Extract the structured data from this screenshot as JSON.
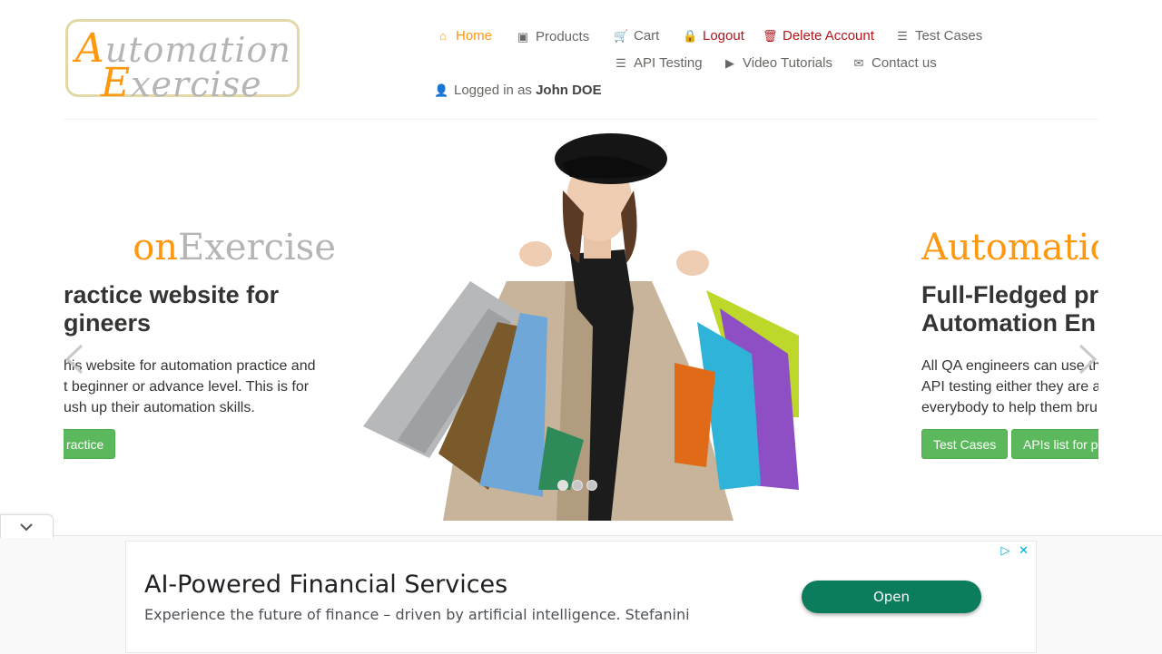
{
  "logo": {
    "line1_cap": "A",
    "line1_rest": "utomation",
    "line2_cap": "E",
    "line2_rest": "xercise"
  },
  "nav": {
    "home": "Home",
    "products": "Products",
    "cart": "Cart",
    "logout": "Logout",
    "delete_account": "Delete Account",
    "test_cases": "Test Cases",
    "api_testing": "API Testing",
    "video_tutorials": "Video Tutorials",
    "contact_us": "Contact us",
    "logged_in_prefix": "Logged in as",
    "logged_in_user": "John DOE"
  },
  "colors": {
    "accent": "#fe980f",
    "danger": "#b4151b",
    "success": "#5cb85c",
    "ad_button": "#0b7d5c"
  },
  "slider": {
    "left": {
      "brand_orange": "on",
      "brand_grey": "Exercise",
      "headline_line1": "ractice website for",
      "headline_line2": "gineers",
      "body_line1": "his website for automation practice and",
      "body_line2": "t beginner or advance level. This is for",
      "body_line3": "ush up their automation skills.",
      "button": "ractice"
    },
    "right": {
      "brand": "Automatic",
      "headline_line1": "Full-Fledged pr",
      "headline_line2": "Automation En",
      "body_line1": "All QA engineers can use th",
      "body_line2": "API testing either they are a",
      "body_line3": "everybody to help them bru",
      "button1": "Test Cases",
      "button2": "APIs list for p"
    },
    "prev_icon": "chevron-left-icon",
    "next_icon": "chevron-right-icon",
    "active_index": 0,
    "dot_count": 3
  },
  "ad": {
    "title": "AI-Powered Financial Services",
    "description": "Experience the future of finance – driven by artificial intelligence. Stefanini",
    "button": "Open"
  }
}
